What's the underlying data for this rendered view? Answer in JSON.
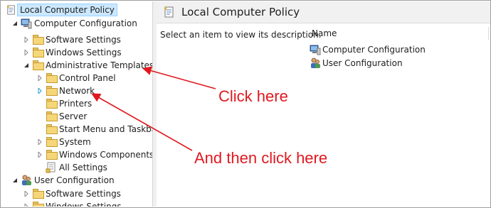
{
  "tree": {
    "root_label": "Local Computer Policy",
    "items": [
      {
        "label": "Computer Configuration"
      },
      {
        "label": "Software Settings"
      },
      {
        "label": "Windows Settings"
      },
      {
        "label": "Administrative Templates"
      },
      {
        "label": "Control Panel"
      },
      {
        "label": "Network"
      },
      {
        "label": "Printers"
      },
      {
        "label": "Server"
      },
      {
        "label": "Start Menu and Taskbar"
      },
      {
        "label": "System"
      },
      {
        "label": "Windows Components"
      },
      {
        "label": "All Settings"
      },
      {
        "label": "User Configuration"
      },
      {
        "label": "Software Settings"
      },
      {
        "label": "Windows Settings"
      }
    ]
  },
  "right_pane": {
    "title": "Local Computer Policy",
    "description": "Select an item to view its description.",
    "column_header": "Name",
    "rows": [
      {
        "label": "Computer Configuration",
        "icon": "computer-icon"
      },
      {
        "label": "User Configuration",
        "icon": "users-icon"
      }
    ]
  },
  "annotations": {
    "first": "Click here",
    "second": "And then click here",
    "color": "#e0191f"
  },
  "colors": {
    "selection": "#cce8ff",
    "selection_border": "#99d1ff",
    "folder": "#f5d77a",
    "header_bg": "#f1f1f1"
  }
}
